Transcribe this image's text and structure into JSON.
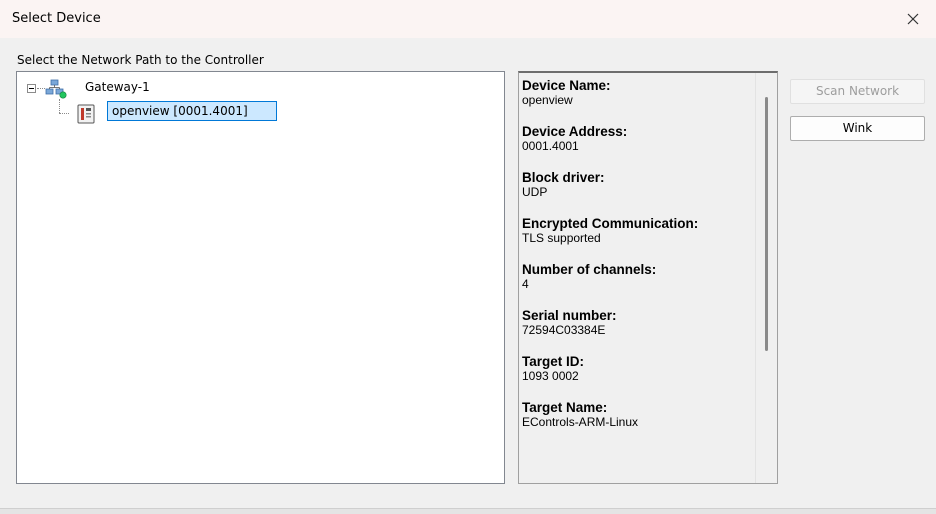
{
  "window": {
    "title": "Select Device",
    "close_icon": "close-x-icon"
  },
  "prompt": "Select the Network Path to the Controller",
  "tree": {
    "gateway": {
      "label": "Gateway-1",
      "icon": "network-gateway-icon",
      "status_color": "#22c55e",
      "expanded": true
    },
    "device": {
      "label": "openview [0001.4001]",
      "icon": "controller-device-icon",
      "selected": true
    }
  },
  "device_info": [
    {
      "key": "Device Name:",
      "value": "openview"
    },
    {
      "key": "Device Address:",
      "value": "0001.4001"
    },
    {
      "key": "Block driver:",
      "value": "UDP"
    },
    {
      "key": "Encrypted Communication:",
      "value": "TLS supported"
    },
    {
      "key": "Number of channels:",
      "value": "4"
    },
    {
      "key": "Serial number:",
      "value": "72594C03384E"
    },
    {
      "key": "Target ID:",
      "value": "1093 0002"
    },
    {
      "key": "Target Name:",
      "value": "EControls-ARM-Linux"
    }
  ],
  "buttons": {
    "scan_network": "Scan Network",
    "scan_network_enabled": false,
    "wink": "Wink"
  },
  "colors": {
    "selection_bg": "#cce8ff",
    "selection_border": "#0078d7"
  }
}
